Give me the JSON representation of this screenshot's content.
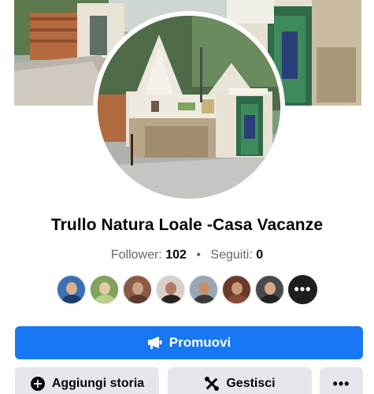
{
  "profile": {
    "name": "Trullo Natura Loale -Casa Vacanze",
    "followers_label": "Follower:",
    "followers_count": "102",
    "separator": "•",
    "following_label": "Seguiti:",
    "following_count": "0"
  },
  "followers_preview": {
    "avatars": [
      {
        "colors": [
          "#3b6fb6",
          "#d9b08c",
          "#1f3c6e"
        ]
      },
      {
        "colors": [
          "#7ea35a",
          "#e4c9a7",
          "#b9d08a"
        ]
      },
      {
        "colors": [
          "#8a5a44",
          "#c9a18a",
          "#5a3a2c"
        ]
      },
      {
        "colors": [
          "#d8cfc8",
          "#b07a66",
          "#2a2220"
        ]
      },
      {
        "colors": [
          "#9aa7b3",
          "#c48e6a",
          "#3c3c3c"
        ]
      },
      {
        "colors": [
          "#6b3a2a",
          "#c99a7c",
          "#8a4a3a"
        ]
      },
      {
        "colors": [
          "#4a4a4a",
          "#d4a888",
          "#222222"
        ]
      }
    ],
    "more_icon": "more-horizontal-icon",
    "more_label": "•••"
  },
  "actions": {
    "promote_label": "Promuovi",
    "promote_icon": "megaphone-icon",
    "add_story_label": "Aggiungi storia",
    "add_story_icon": "plus-circle-icon",
    "manage_label": "Gestisci",
    "manage_icon": "tools-icon",
    "more_label": "•••",
    "more_icon": "more-horizontal-icon"
  },
  "colors": {
    "primary": "#1877f2",
    "secondary_button": "#e4e6eb",
    "text_primary": "#050505",
    "text_secondary": "#65676b"
  }
}
